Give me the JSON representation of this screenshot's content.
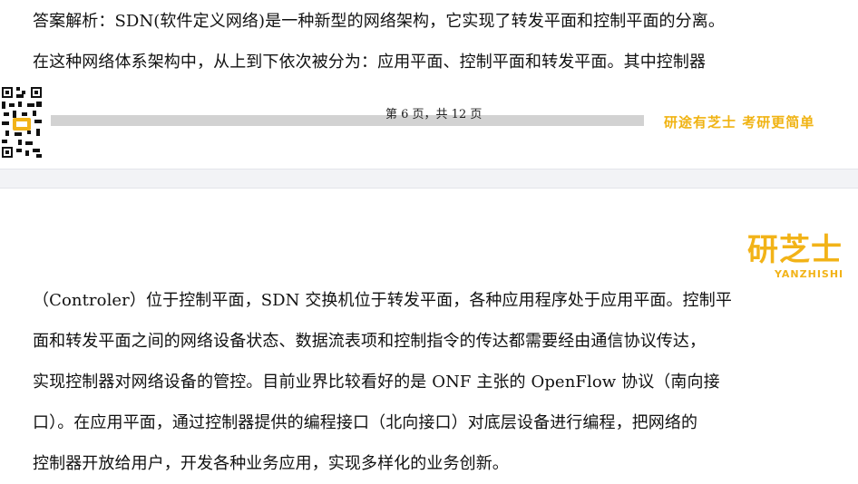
{
  "top_page": {
    "lines": [
      "答案解析：SDN(软件定义网络)是一种新型的网络架构，它实现了转发平面和控制平面的分离。",
      "在这种网络体系架构中，从上到下依次被分为：应用平面、控制平面和转发平面。其中控制器"
    ],
    "footer": {
      "page_number": "第 6 页，共 12 页",
      "slogan": "研途有芝士 考研更简单"
    }
  },
  "bottom_page": {
    "logo": {
      "main": "研芝士",
      "sub": "YANZHISHI"
    },
    "lines": [
      "（Controler）位于控制平面，SDN 交换机位于转发平面，各种应用程序处于应用平面。控制平",
      "面和转发平面之间的网络设备状态、数据流表项和控制指令的传达都需要经由通信协议传达，",
      "实现控制器对网络设备的管控。目前业界比较看好的是 ONF 主张的 OpenFlow 协议（南向接",
      "口）。在应用平面，通过控制器提供的编程接口（北向接口）对底层设备进行编程，把网络的",
      "控制器开放给用户，开发各种业务应用，实现多样化的业务创新。"
    ]
  },
  "colors": {
    "brand_yellow": "#f2b318",
    "footer_bar": "#d2d2d2",
    "page_gap": "#f2f3f6"
  },
  "icons": {
    "qr": "qr-code-icon"
  }
}
